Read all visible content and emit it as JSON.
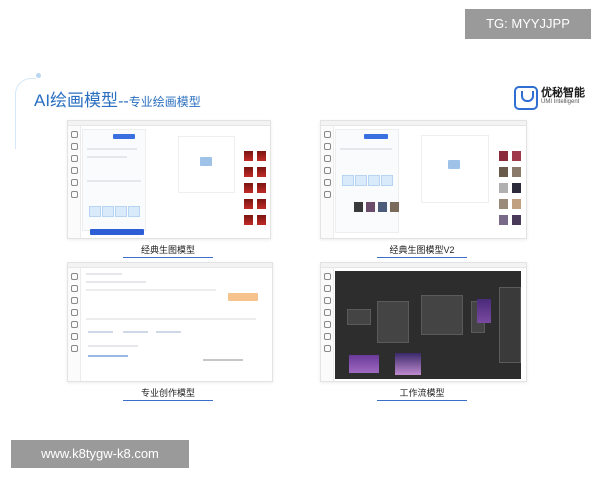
{
  "watermark_top": "TG: MYYJJPP",
  "watermark_bottom": "www.k8tygw-k8.com",
  "header": {
    "title_main": "AI绘画模型",
    "title_sep": "--",
    "title_sub": "专业绘画模型"
  },
  "logo": {
    "name_cn": "优秘智能",
    "name_en": "UMI Intelligent"
  },
  "screens": [
    {
      "caption": "经典生图模型"
    },
    {
      "caption": "经典生图模型V2"
    },
    {
      "caption": "专业创作模型"
    },
    {
      "caption": "工作流模型"
    }
  ],
  "colors": {
    "accent": "#2a6fc0",
    "primary_button": "#2d5ed6",
    "watermark_bg": "#9a9a9a",
    "workflow_bg": "#2d2d2d"
  }
}
